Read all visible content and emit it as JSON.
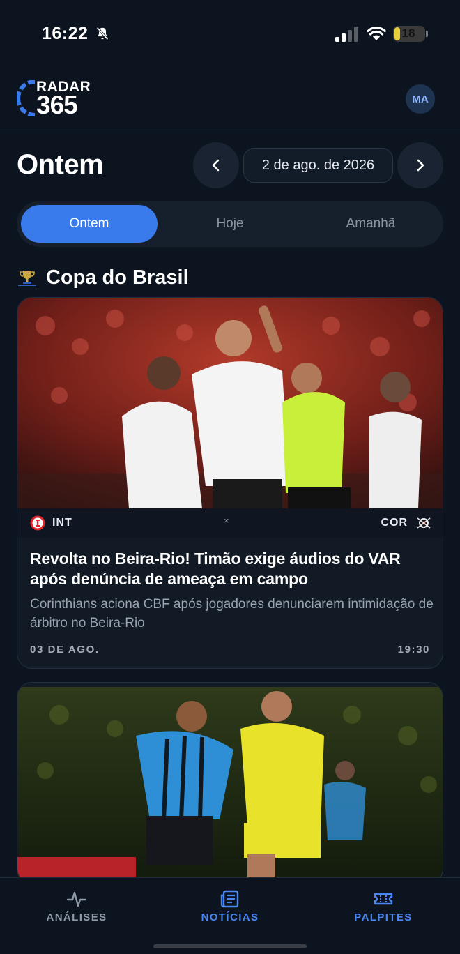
{
  "status_bar": {
    "time": "16:22",
    "battery": "18",
    "battery_level": 0.18,
    "icons": [
      "bell-slash-icon",
      "signal-icon",
      "wifi-icon",
      "battery-icon"
    ]
  },
  "header": {
    "logo_top": "RADAR",
    "logo_bottom": "365",
    "avatar": "MA"
  },
  "date_nav": {
    "title": "Ontem",
    "date": "2 de ago. de 2026",
    "prev_icon": "chevron-left-icon",
    "next_icon": "chevron-right-icon"
  },
  "tabs": [
    {
      "label": "Ontem",
      "active": true
    },
    {
      "label": "Hoje",
      "active": false
    },
    {
      "label": "Amanhã",
      "active": false
    }
  ],
  "section": {
    "title": "Copa do Brasil",
    "icon": "trophy-icon"
  },
  "articles": [
    {
      "home_team": "INT",
      "away_team": "COR",
      "separator": "×",
      "headline": "Revolta no Beira-Rio! Timão exige áudios do VAR após denúncia de ameaça em campo",
      "subtitle": "Corinthians aciona CBF após jogadores denunciarem intimidação de árbitro no Beira-Rio",
      "date": "03 DE AGO.",
      "time": "19:30"
    }
  ],
  "bottom_nav": [
    {
      "label": "ANÁLISES",
      "icon": "activity-icon",
      "color": "#9099a7"
    },
    {
      "label": "NOTÍCIAS",
      "icon": "newspaper-icon",
      "color": "#4a86f0"
    },
    {
      "label": "PALPITES",
      "icon": "ticket-icon",
      "color": "#4a86f0"
    }
  ],
  "colors": {
    "background": "#0c1420",
    "accent": "#3a7bec",
    "card": "#121a26"
  }
}
